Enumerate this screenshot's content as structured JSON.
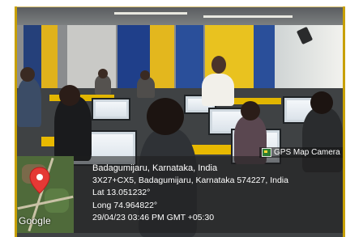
{
  "overlay": {
    "app_badge": "GPS Map Camera",
    "place": "Badagumijaru, Karnataka, India",
    "address": "3X27+CX5, Badagumijaru, Karnataka 574227, India",
    "latitude": "Lat 13.051232°",
    "longitude": "Long 74.964822°",
    "datetime": "29/04/23 03:46 PM GMT +05:30",
    "map_logo": "Google",
    "pin_icon": "location-pin-icon",
    "badge_icon": "map-camera-icon"
  },
  "colors": {
    "frame": "#c8a000",
    "pin": "#e53935",
    "overlay_text": "#ffffff"
  }
}
